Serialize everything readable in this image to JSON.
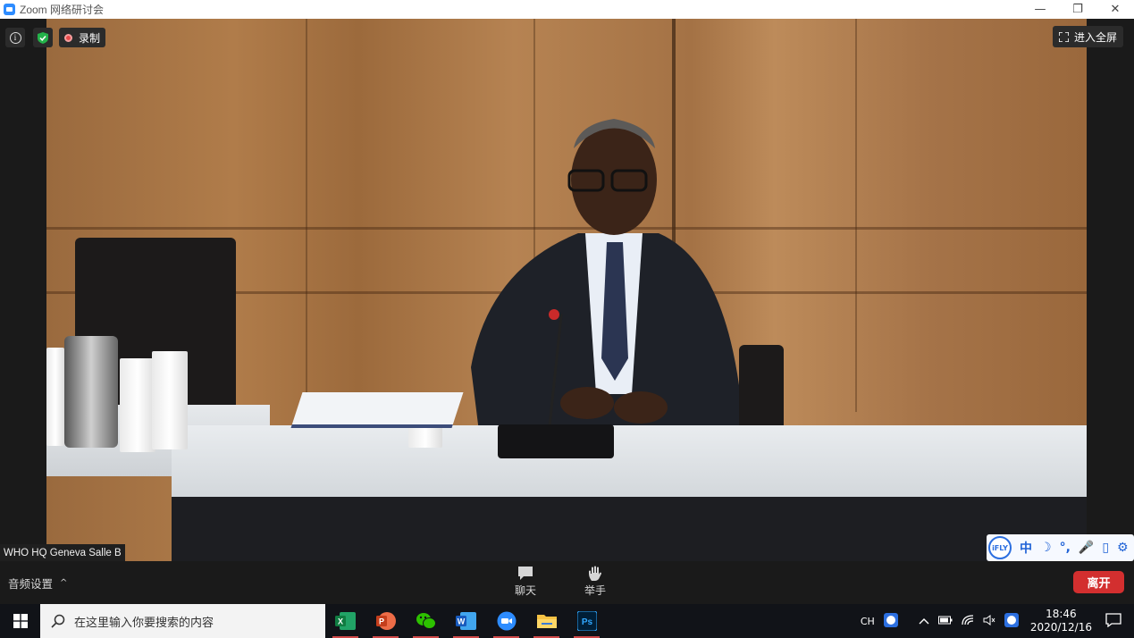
{
  "window": {
    "title": "Zoom 网络研讨会",
    "minimize": "—",
    "restore": "❐",
    "close": "✕"
  },
  "meeting": {
    "recording_label": "录制",
    "fullscreen_label": "进入全屏",
    "participant_name": "WHO HQ Geneva Salle B"
  },
  "ifly_toolbar": {
    "badge": "iFLY",
    "items": [
      "中",
      "☽",
      "°,",
      "🎤",
      "▯",
      "⚙"
    ]
  },
  "controls": {
    "audio_settings": "音频设置",
    "caret": "^",
    "chat_label": "聊天",
    "raise_hand_label": "举手",
    "leave_label": "离开"
  },
  "taskbar": {
    "search_placeholder": "在这里输入你要搜索的内容",
    "apps": [
      "excel",
      "powerpoint",
      "wechat",
      "word",
      "zoom",
      "file-explorer",
      "photoshop"
    ],
    "ime": "CH",
    "time": "18:46",
    "date": "2020/12/16"
  },
  "colors": {
    "accent": "#2d8cff",
    "leave": "#d32f2f",
    "background": "#1a1a1a"
  }
}
